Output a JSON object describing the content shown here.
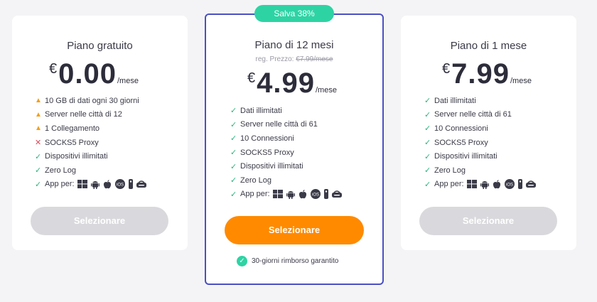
{
  "badge": "Salva 38%",
  "colors": {
    "accent": "#4a4fc4",
    "badge": "#2ed3a4",
    "cta": "#ff8a00",
    "check": "#2bb57d",
    "warn": "#f0a020",
    "cross": "#e04b5a"
  },
  "plans": [
    {
      "title": "Piano gratuito",
      "currency": "€",
      "amount": "0.00",
      "per": "/mese",
      "features": [
        {
          "icon": "warning-icon",
          "text": "10 GB di dati ogni 30 giorni"
        },
        {
          "icon": "warning-icon",
          "text": "Server nelle città di 12"
        },
        {
          "icon": "warning-icon",
          "text": "1 Collegamento"
        },
        {
          "icon": "x-icon",
          "text": "SOCKS5 Proxy"
        },
        {
          "icon": "check-icon",
          "text": "Dispositivi illimitati"
        },
        {
          "icon": "check-icon",
          "text": "Zero Log"
        },
        {
          "icon": "check-icon",
          "text": "App per:"
        }
      ],
      "button": "Selezionare"
    },
    {
      "title": "Piano di 12 mesi",
      "reg_label": "reg. Prezzo:",
      "reg_price": "€7.99/mese",
      "currency": "€",
      "amount": "4.99",
      "per": "/mese",
      "features": [
        {
          "icon": "check-icon",
          "text": "Dati illimitati"
        },
        {
          "icon": "check-icon",
          "text": "Server nelle città di 61"
        },
        {
          "icon": "check-icon",
          "text": "10 Connessioni"
        },
        {
          "icon": "check-icon",
          "text": "SOCKS5 Proxy"
        },
        {
          "icon": "check-icon",
          "text": "Dispositivi illimitati"
        },
        {
          "icon": "check-icon",
          "text": "Zero Log"
        },
        {
          "icon": "check-icon",
          "text": "App per:"
        }
      ],
      "button": "Selezionare",
      "guarantee": "30-giorni rimborso garantito"
    },
    {
      "title": "Piano di 1 mese",
      "currency": "€",
      "amount": "7.99",
      "per": "/mese",
      "features": [
        {
          "icon": "check-icon",
          "text": "Dati illimitati"
        },
        {
          "icon": "check-icon",
          "text": "Server nelle città di 61"
        },
        {
          "icon": "check-icon",
          "text": "10 Connessioni"
        },
        {
          "icon": "check-icon",
          "text": "SOCKS5 Proxy"
        },
        {
          "icon": "check-icon",
          "text": "Dispositivi illimitati"
        },
        {
          "icon": "check-icon",
          "text": "Zero Log"
        },
        {
          "icon": "check-icon",
          "text": "App per:"
        }
      ],
      "button": "Selezionare"
    }
  ],
  "app_platform_icons": [
    "windows-icon",
    "android-icon",
    "apple-icon",
    "ios-icon",
    "remote-icon",
    "router-icon"
  ]
}
